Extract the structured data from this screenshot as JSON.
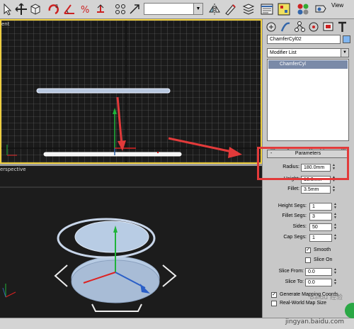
{
  "toolbar": {
    "view_label": "View",
    "icons": [
      "select-object-icon",
      "select-by-name-icon",
      "select-move-icon",
      "select-rotate-icon",
      "snap-toggle-icon",
      "angle-snap-icon",
      "percent-snap-icon",
      "spinner-snap-icon",
      "named-selection-icon",
      "mirror-icon",
      "align-icon",
      "layer-manager-icon",
      "curve-editor-icon",
      "schematic-view-icon",
      "material-editor-icon",
      "render-setup-icon",
      "render-icon"
    ]
  },
  "viewports": {
    "top_label": "ent",
    "perspective_label": "erspective"
  },
  "panel": {
    "object_name": "ChamferCyl02",
    "object_color": "#7fb5f0",
    "modifier_list_label": "Modifier List",
    "stack_item": "ChamferCyl",
    "rollout_title": "Parameters",
    "params": [
      {
        "label": "Radius:",
        "value": "180.0mm"
      },
      {
        "label": "Height:",
        "value": "10.0mm"
      },
      {
        "label": "Fillet:",
        "value": "3.5mm"
      },
      {
        "label": "Height Segs:",
        "value": "1"
      },
      {
        "label": "Fillet Segs:",
        "value": "3"
      },
      {
        "label": "Sides:",
        "value": "50"
      },
      {
        "label": "Cap Segs:",
        "value": "1"
      }
    ],
    "smooth_label": "Smooth",
    "smooth_checked": "✓",
    "slice_on_label": "Slice On",
    "slice_from_label": "Slice From:",
    "slice_from_value": "0.0",
    "slice_to_label": "Slice To:",
    "slice_to_value": "0.0",
    "gen_mapping_label": "Generate Mapping Coords.",
    "gen_mapping_checked": "✓",
    "real_world_label": "Real-World Map Size"
  },
  "watermark": {
    "logo": "Baidu 经验",
    "url": "jingyan.baidu.com"
  },
  "colors": {
    "highlight": "#e23a3a",
    "selection_border": "#f0d040",
    "viewport_bg": "#1a1a1a"
  }
}
